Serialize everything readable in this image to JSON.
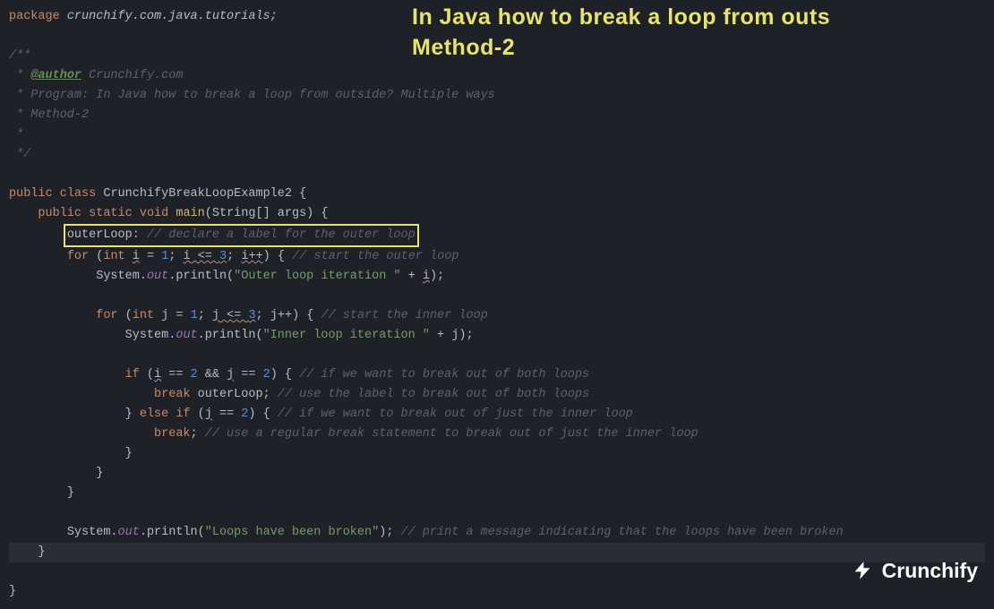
{
  "title_overlay": {
    "line1": "In Java how to break a loop from outs",
    "line2": "Method-2"
  },
  "code": {
    "package_kw": "package",
    "package_name": " crunchify.com.java.tutorials;",
    "doc_open": "/**",
    "doc_author_prefix": " * ",
    "doc_author_tag": "@author",
    "doc_author_val": " Crunchify.com",
    "doc_program": " * Program: In Java how to break a loop from outside? Multiple ways",
    "doc_method": " * Method-2",
    "doc_star": " *",
    "doc_close": " */",
    "public": "public",
    "class": "class",
    "classname": "CrunchifyBreakLoopExample2",
    "static": "static",
    "void": "void",
    "main": "main",
    "main_args": "(String[] args)",
    "label_name": "outerLoop:",
    "label_comment": " // declare a label for the outer loop",
    "for": "for",
    "int": "int",
    "i": "i",
    "j": "j",
    "eq": " = ",
    "one": "1",
    "two": "2",
    "three": "3",
    "semi": ";",
    "lte": " <= ",
    "pp_i": "i++",
    "pp_j": "j++",
    "outer_for_comment": " // start the outer loop",
    "inner_for_comment": " // start the inner loop",
    "sys": "System.",
    "out": "out",
    "println": ".println(",
    "str_outer": "\"Outer loop iteration \"",
    "str_inner": "\"Inner loop iteration \"",
    "str_broken": "\"Loops have been broken\"",
    "plus": " + ",
    "close_call": ");",
    "if": "if",
    "else": "else",
    "cond1": " (",
    "eqeq": " == ",
    "andand": " && ",
    "if1_comment": " // if we want to break out of both loops",
    "break": "break",
    "break_label": " outerLoop;",
    "break1_comment": " // use the label to break out of both loops",
    "elseif_comment": " // if we want to break out of just the inner loop",
    "break_plain": ";",
    "break2_comment": " // use a regular break statement to break out of just the inner loop",
    "final_comment": " // print a message indicating that the loops have been broken",
    "brace_open": " {",
    "brace_close": "}",
    "paren_close": ")"
  },
  "logo": {
    "text": "Crunchify"
  }
}
